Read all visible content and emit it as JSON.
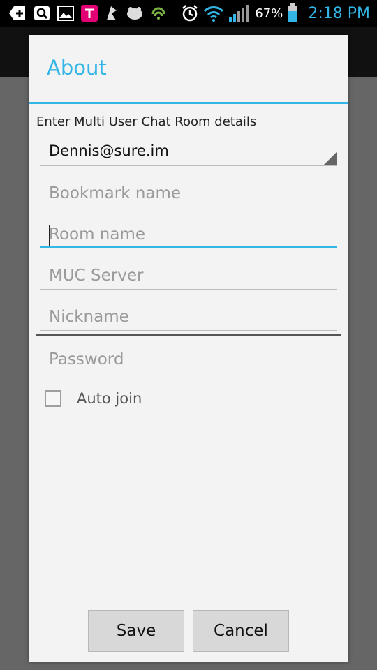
{
  "status_bar": {
    "battery_percent": "67%",
    "time": "2:18 PM",
    "icons": [
      "add-icon",
      "search-app-icon",
      "image-icon",
      "tmobile-icon",
      "sure-im-icon",
      "bear-icon",
      "android-icon",
      "alarm-icon",
      "wifi-icon",
      "signal-icon",
      "battery-icon"
    ]
  },
  "dialog": {
    "title": "About",
    "intro": "Enter Multi User Chat Room details",
    "account_value": "Dennis@sure.im",
    "fields": {
      "bookmark_placeholder": "Bookmark name",
      "room_placeholder": "Room name",
      "server_placeholder": "MUC Server",
      "nickname_placeholder": "Nickname",
      "password_placeholder": "Password"
    },
    "auto_join_label": "Auto join",
    "save_label": "Save",
    "cancel_label": "Cancel"
  },
  "colors": {
    "accent": "#33b5e5",
    "dialog_bg": "#f3f3f3",
    "dim_bg": "#5e5e5e"
  }
}
